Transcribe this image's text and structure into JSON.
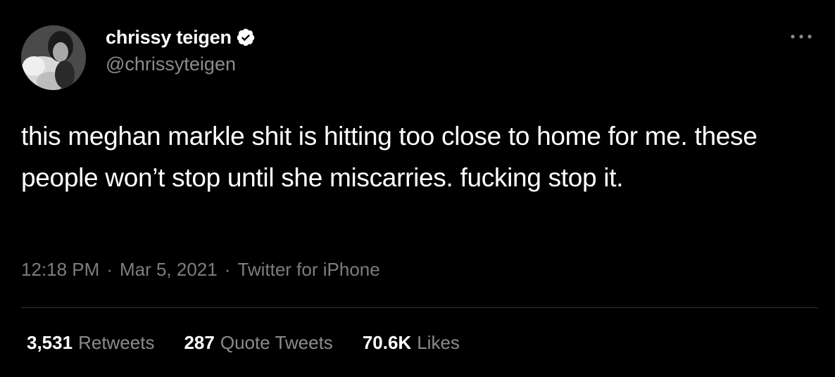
{
  "author": {
    "display_name": "chrissy teigen",
    "handle": "@chrissyteigen",
    "verified_icon": "verified-badge-icon"
  },
  "tweet": {
    "text": "this meghan markle shit is hitting too close to home for me. these people won’t stop until she miscarries. fucking stop it.",
    "time": "12:18 PM",
    "date": "Mar 5, 2021",
    "source": "Twitter for iPhone",
    "separator": "·"
  },
  "stats": {
    "retweets_count": "3,531",
    "retweets_label": "Retweets",
    "quote_count": "287",
    "quote_label": "Quote Tweets",
    "likes_count": "70.6K",
    "likes_label": "Likes"
  },
  "colors": {
    "background": "#000000",
    "primary_text": "#ffffff",
    "secondary_text": "#8b8b8b",
    "divider": "#2f2f2f"
  },
  "icons": {
    "more": "more-options-icon",
    "verified": "verified-badge-icon"
  }
}
